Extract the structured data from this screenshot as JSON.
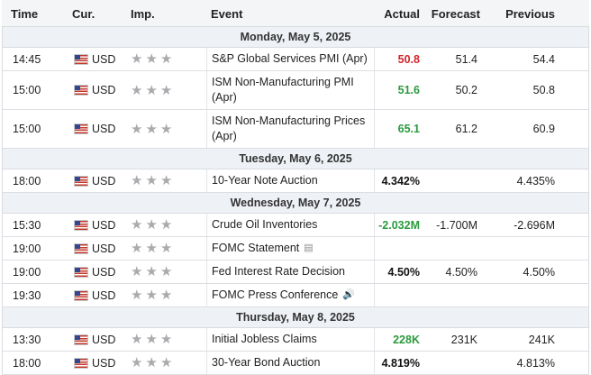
{
  "header": {
    "time": "Time",
    "cur": "Cur.",
    "imp": "Imp.",
    "event": "Event",
    "actual": "Actual",
    "forecast": "Forecast",
    "previous": "Previous"
  },
  "colors": {
    "positive": "#2a9a3d",
    "negative": "#d2242b",
    "star": "#a9abae",
    "day_bg": "#eef1f6"
  },
  "days": [
    {
      "label": "Monday, May 5, 2025",
      "events": [
        {
          "time": "14:45",
          "currency": "USD",
          "event": "S&P Global Services PMI (Apr)",
          "actual": "50.8",
          "actual_tone": "negative",
          "forecast": "51.4",
          "previous": "54.4",
          "importance_stars": 3
        },
        {
          "time": "15:00",
          "currency": "USD",
          "event": "ISM Non-Manufacturing PMI (Apr)",
          "actual": "51.6",
          "actual_tone": "positive",
          "forecast": "50.2",
          "previous": "50.8",
          "importance_stars": 3
        },
        {
          "time": "15:00",
          "currency": "USD",
          "event": "ISM Non-Manufacturing Prices (Apr)",
          "actual": "65.1",
          "actual_tone": "positive",
          "forecast": "61.2",
          "previous": "60.9",
          "importance_stars": 3
        }
      ]
    },
    {
      "label": "Tuesday, May 6, 2025",
      "events": [
        {
          "time": "18:00",
          "currency": "USD",
          "event": "10-Year Note Auction",
          "actual": "4.342%",
          "actual_tone": "neutral",
          "forecast": "",
          "previous": "4.435%",
          "importance_stars": 3
        }
      ]
    },
    {
      "label": "Wednesday, May 7, 2025",
      "events": [
        {
          "time": "15:30",
          "currency": "USD",
          "event": "Crude Oil Inventories",
          "actual": "-2.032M",
          "actual_tone": "positive",
          "forecast": "-1.700M",
          "previous": "-2.696M",
          "importance_stars": 3
        },
        {
          "time": "19:00",
          "currency": "USD",
          "event": "FOMC Statement",
          "actual": "",
          "actual_tone": "neutral",
          "forecast": "",
          "previous": "",
          "importance_stars": 3,
          "icon": "document-icon"
        },
        {
          "time": "19:00",
          "currency": "USD",
          "event": "Fed Interest Rate Decision",
          "actual": "4.50%",
          "actual_tone": "neutral",
          "forecast": "4.50%",
          "previous": "4.50%",
          "importance_stars": 3
        },
        {
          "time": "19:30",
          "currency": "USD",
          "event": "FOMC Press Conference",
          "actual": "",
          "actual_tone": "neutral",
          "forecast": "",
          "previous": "",
          "importance_stars": 3,
          "icon": "speaker-icon"
        }
      ]
    },
    {
      "label": "Thursday, May 8, 2025",
      "events": [
        {
          "time": "13:30",
          "currency": "USD",
          "event": "Initial Jobless Claims",
          "actual": "228K",
          "actual_tone": "positive",
          "forecast": "231K",
          "previous": "241K",
          "importance_stars": 3
        },
        {
          "time": "18:00",
          "currency": "USD",
          "event": "30-Year Bond Auction",
          "actual": "4.819%",
          "actual_tone": "neutral",
          "forecast": "",
          "previous": "4.813%",
          "importance_stars": 3
        }
      ]
    }
  ]
}
